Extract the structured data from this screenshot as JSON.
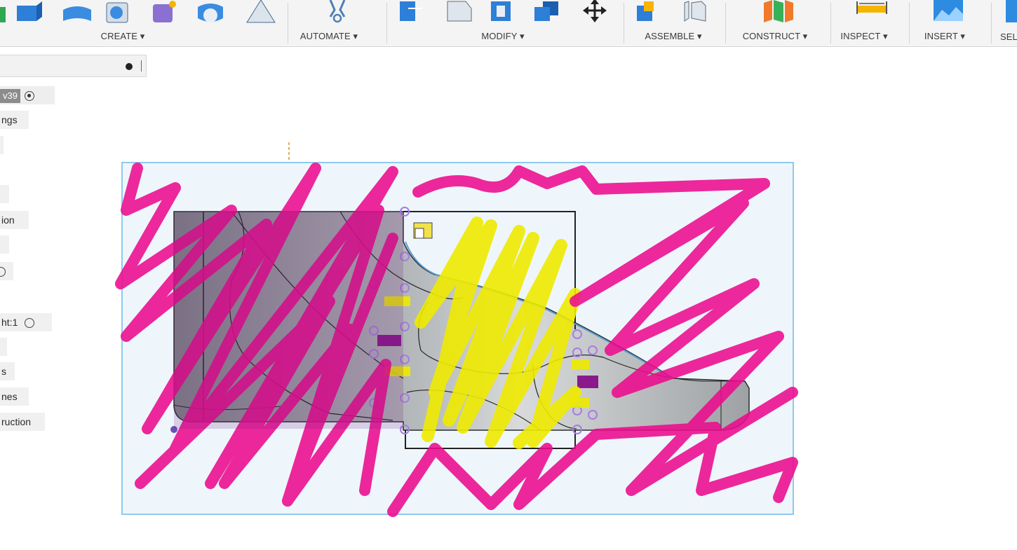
{
  "toolbar": {
    "groups": [
      {
        "label": "CREATE ▾"
      },
      {
        "label": "AUTOMATE ▾"
      },
      {
        "label": "MODIFY ▾"
      },
      {
        "label": "ASSEMBLE ▾"
      },
      {
        "label": "CONSTRUCT ▾"
      },
      {
        "label": "INSPECT ▾"
      },
      {
        "label": "INSERT ▾"
      },
      {
        "label": "SEL"
      }
    ]
  },
  "browser": {
    "nodes": [
      {
        "label": "v39",
        "icon": "radio-selected"
      },
      {
        "label": "ngs"
      },
      {
        "label": ""
      },
      {
        "label": ""
      },
      {
        "label": "ion"
      },
      {
        "label": ""
      },
      {
        "label": "",
        "icon": "radio"
      },
      {
        "label": "ht:1",
        "icon": "radio"
      },
      {
        "label": ""
      },
      {
        "label": "s"
      },
      {
        "label": "nes"
      },
      {
        "label": "ruction"
      }
    ]
  },
  "colors": {
    "canvas_frame": "#8fc9ec",
    "canvas_bg": "#eef6fc",
    "pink_annotation": "#ec0b8e",
    "yellow_annotation": "#eeea00",
    "sketch_point": "#a67de0",
    "part_gray": "#8a8f92"
  }
}
